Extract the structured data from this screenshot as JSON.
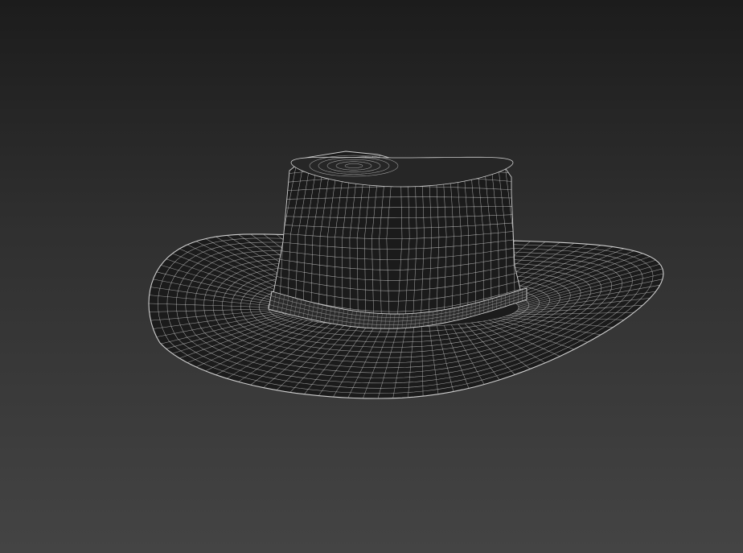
{
  "viewport": {
    "background_top": "#1c1c1c",
    "background_bottom": "#444444",
    "render_mode": "wireframe-on-shaded"
  },
  "model": {
    "object": "hat-mesh",
    "shaded_color": "#1b1b1b",
    "wire_color": "#cfcfcf"
  }
}
